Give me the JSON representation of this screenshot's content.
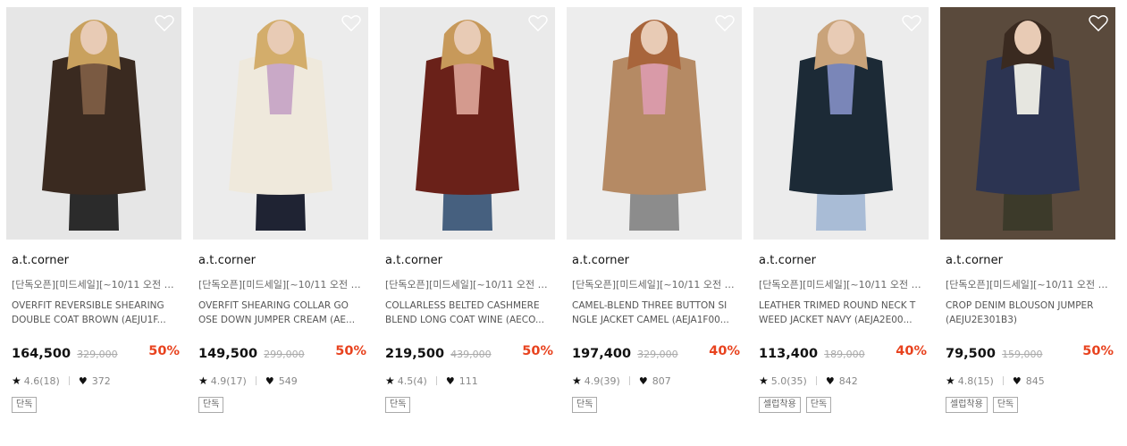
{
  "colors": {
    "discount": "#e8431f",
    "price": "#111111",
    "muted": "#888888"
  },
  "products": [
    {
      "brand": "a.t.corner",
      "promo": "[단독오픈][미드세일][~10/11 오전 10...",
      "name_line1": "OVERFIT REVERSIBLE SHEARING",
      "name_line2": "DOUBLE COAT BROWN (AEJU1F...",
      "price": "164,500",
      "original_price": "329,000",
      "discount": "50%",
      "rating": "4.6(18)",
      "likes": "372",
      "tags": [
        "단독"
      ],
      "photo": {
        "bg": "#e6e6e6",
        "coat": "#3a2a20",
        "inner": "#7a5a42",
        "hair": "#c9a15e",
        "bottom": "#2b2b2b"
      }
    },
    {
      "brand": "a.t.corner",
      "promo": "[단독오픈][미드세일][~10/11 오전 10...",
      "name_line1": "OVERFIT SHEARING COLLAR GO",
      "name_line2": "OSE DOWN JUMPER CREAM (AE...",
      "price": "149,500",
      "original_price": "299,000",
      "discount": "50%",
      "rating": "4.9(17)",
      "likes": "549",
      "tags": [
        "단독"
      ],
      "photo": {
        "bg": "#ececec",
        "coat": "#efe9dc",
        "inner": "#c9a9c7",
        "hair": "#d3ad6b",
        "bottom": "#1f2333"
      }
    },
    {
      "brand": "a.t.corner",
      "promo": "[단독오픈][미드세일][~10/11 오전 10...",
      "name_line1": "COLLARLESS BELTED CASHMERE",
      "name_line2": "BLEND LONG COAT WINE (AECO...",
      "price": "219,500",
      "original_price": "439,000",
      "discount": "50%",
      "rating": "4.5(4)",
      "likes": "111",
      "tags": [
        "단독"
      ],
      "photo": {
        "bg": "#eaeaea",
        "coat": "#6a2119",
        "inner": "#d49a8e",
        "hair": "#c7995a",
        "bottom": "#46607f"
      }
    },
    {
      "brand": "a.t.corner",
      "promo": "[단독오픈][미드세일][~10/11 오전 10...",
      "name_line1": "CAMEL-BLEND THREE BUTTON SI",
      "name_line2": "NGLE JACKET CAMEL (AEJA1F00...",
      "price": "197,400",
      "original_price": "329,000",
      "discount": "40%",
      "rating": "4.9(39)",
      "likes": "807",
      "tags": [
        "단독"
      ],
      "photo": {
        "bg": "#ededed",
        "coat": "#b58a64",
        "inner": "#d99aa8",
        "hair": "#a8653b",
        "bottom": "#8c8c8c"
      }
    },
    {
      "brand": "a.t.corner",
      "promo": "[단독오픈][미드세일][~10/11 오전 10...",
      "name_line1": "LEATHER TRIMED ROUND NECK T",
      "name_line2": "WEED JACKET NAVY (AEJA2E00...",
      "price": "113,400",
      "original_price": "189,000",
      "discount": "40%",
      "rating": "5.0(35)",
      "likes": "842",
      "tags": [
        "셀럽착용",
        "단독"
      ],
      "photo": {
        "bg": "#ececec",
        "coat": "#1c2a36",
        "inner": "#7a86b8",
        "hair": "#c9a37a",
        "bottom": "#a9bcd6"
      }
    },
    {
      "brand": "a.t.corner",
      "promo": "[단독오픈][미드세일][~10/11 오전 10...",
      "name_line1": "CROP DENIM BLOUSON JUMPER",
      "name_line2": "(AEJU2E301B3)",
      "price": "79,500",
      "original_price": "159,000",
      "discount": "50%",
      "rating": "4.8(15)",
      "likes": "845",
      "tags": [
        "셀럽착용",
        "단독"
      ],
      "photo": {
        "bg": "#5a4a3c",
        "coat": "#2c3452",
        "inner": "#e6e6e0",
        "hair": "#3a2a20",
        "bottom": "#3c3a2a"
      }
    }
  ]
}
